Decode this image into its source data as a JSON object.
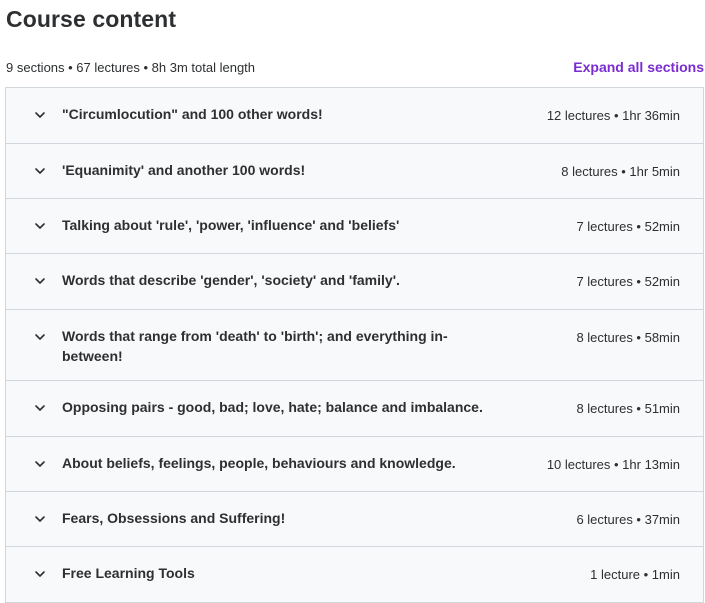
{
  "header": {
    "title": "Course content",
    "summary": "9 sections • 67 lectures • 8h 3m total length",
    "expand_label": "Expand all sections"
  },
  "sections": [
    {
      "title": "\"Circumlocution\" and 100 other words!",
      "meta": "12 lectures • 1hr 36min"
    },
    {
      "title": "'Equanimity' and another 100 words!",
      "meta": "8 lectures • 1hr 5min"
    },
    {
      "title": "Talking about 'rule', 'power, 'influence' and 'beliefs'",
      "meta": "7 lectures • 52min"
    },
    {
      "title": "Words that describe 'gender', 'society' and 'family'.",
      "meta": "7 lectures • 52min"
    },
    {
      "title": "Words that range from 'death' to 'birth'; and everything in-between!",
      "meta": "8 lectures • 58min"
    },
    {
      "title": "Opposing pairs - good, bad; love, hate; balance and imbalance.",
      "meta": "8 lectures • 51min"
    },
    {
      "title": "About beliefs, feelings, people, behaviours and knowledge.",
      "meta": "10 lectures • 1hr 13min"
    },
    {
      "title": "Fears, Obsessions and Suffering!",
      "meta": "6 lectures • 37min"
    },
    {
      "title": "Free Learning Tools",
      "meta": "1 lecture • 1min"
    }
  ],
  "colors": {
    "accent": "#7a2cd0",
    "section_bg": "#f7f9fa",
    "border": "#d1d7dc",
    "text": "#2d2f31"
  },
  "icons": {
    "section_toggle": "chevron-down-icon"
  }
}
